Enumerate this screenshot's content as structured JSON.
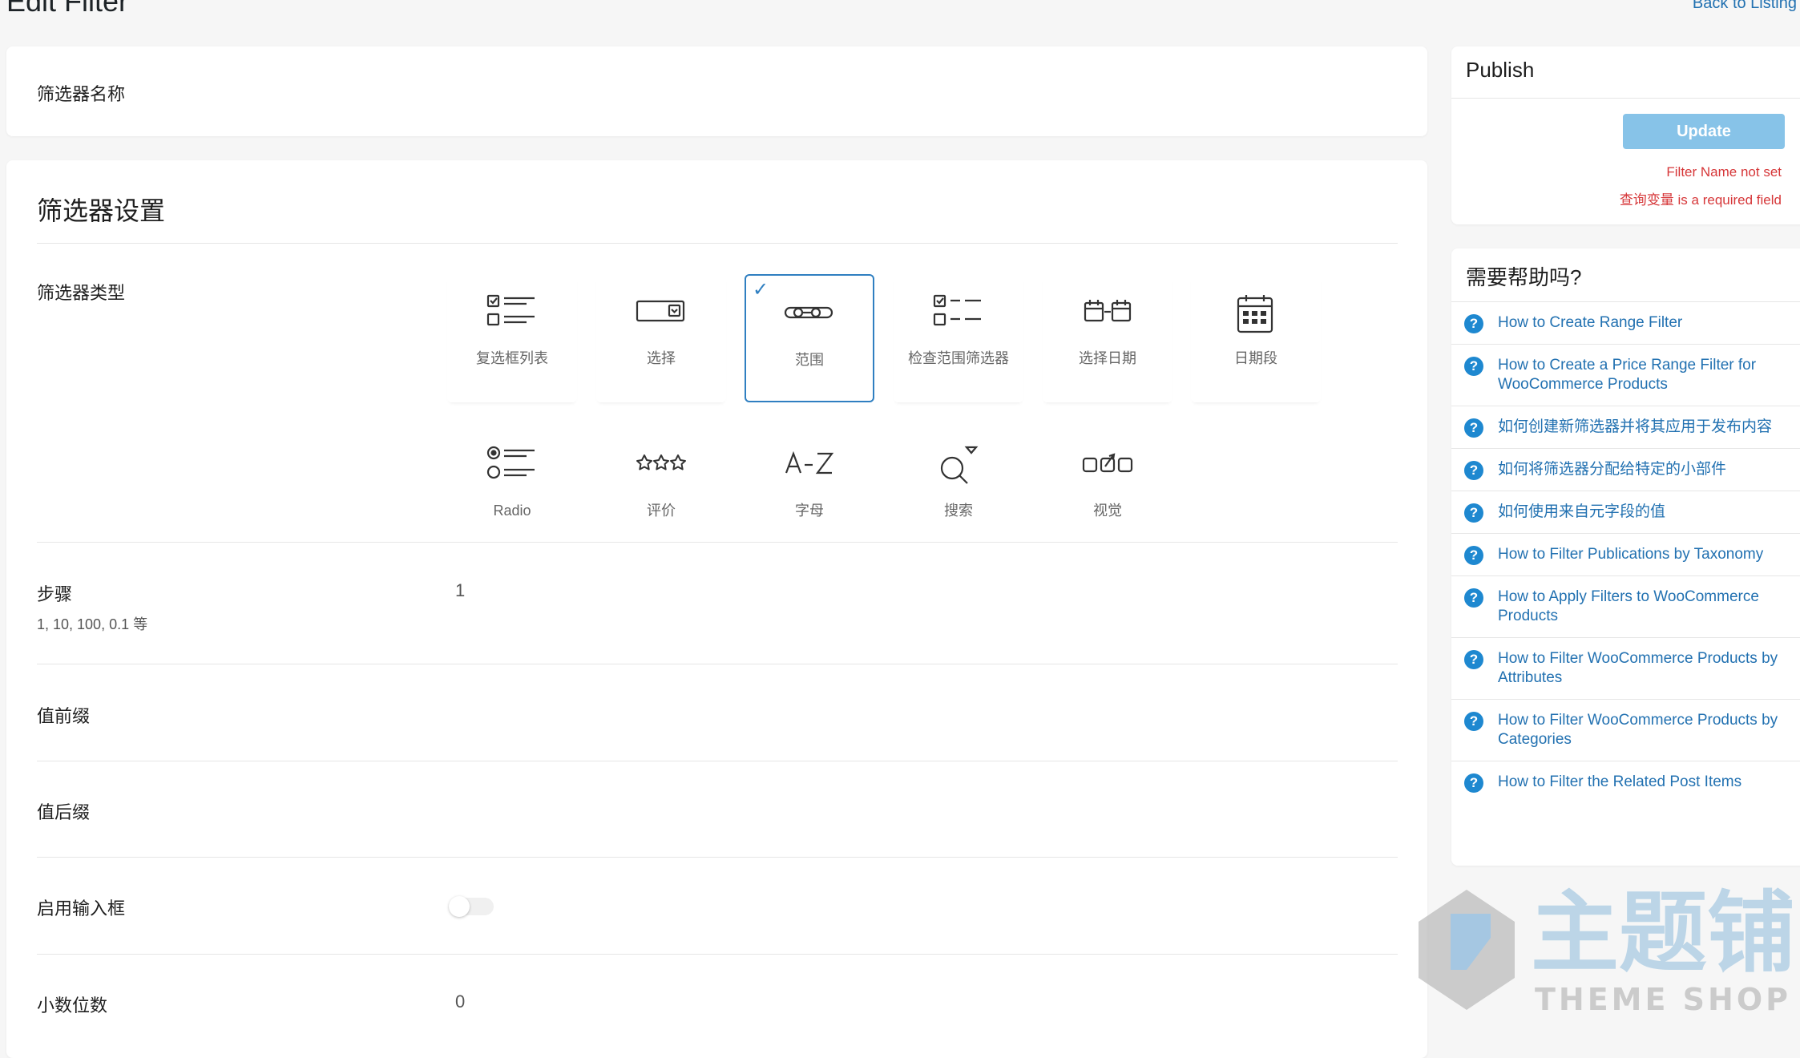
{
  "header": {
    "title": "Edit Filter",
    "back_link": "Back to Listing"
  },
  "name_section": {
    "label": "筛选器名称"
  },
  "settings": {
    "title": "筛选器设置",
    "type_label": "筛选器类型",
    "types": [
      {
        "label": "复选框列表",
        "icon": "checkbox-list-icon"
      },
      {
        "label": "选择",
        "icon": "select-icon"
      },
      {
        "label": "范围",
        "icon": "range-icon",
        "selected": true
      },
      {
        "label": "检查范围筛选器",
        "icon": "check-range-icon"
      },
      {
        "label": "选择日期",
        "icon": "date-select-icon"
      },
      {
        "label": "日期段",
        "icon": "calendar-icon"
      },
      {
        "label": "Radio",
        "icon": "radio-list-icon"
      },
      {
        "label": "评价",
        "icon": "rating-stars-icon"
      },
      {
        "label": "字母",
        "icon": "alphabet-icon"
      },
      {
        "label": "搜索",
        "icon": "search-icon"
      },
      {
        "label": "视觉",
        "icon": "visual-icon"
      }
    ],
    "step": {
      "label": "步骤",
      "hint": "1, 10, 100, 0.1 等",
      "value": "1"
    },
    "prefix": {
      "label": "值前缀"
    },
    "suffix": {
      "label": "值后缀"
    },
    "enable_input": {
      "label": "启用输入框",
      "enabled": false
    },
    "decimals": {
      "label": "小数位数",
      "value": "0"
    }
  },
  "publish": {
    "title": "Publish",
    "update_label": "Update",
    "errors": [
      "Filter Name not set",
      "查询变量 is a required field"
    ]
  },
  "help": {
    "title": "需要帮助吗?",
    "items": [
      "How to Create Range Filter",
      "How to Create a Price Range Filter for WooCommerce Products",
      "如何创建新筛选器并将其应用于发布内容",
      "如何将筛选器分配给特定的小部件",
      "如何使用来自元字段的值",
      "How to Filter Publications by Taxonomy",
      "How to Apply Filters to WooCommerce Products",
      "How to Filter WooCommerce Products by Attributes",
      "How to Filter WooCommerce Products by Categories",
      "How to Filter the Related Post Items"
    ]
  },
  "watermark": {
    "brand": "主题铺",
    "sub": "THEME SHOP"
  },
  "colors": {
    "accent": "#2271b1",
    "selected_border": "#2f7fc1",
    "error": "#d63638",
    "update_button": "#87c3e8"
  }
}
